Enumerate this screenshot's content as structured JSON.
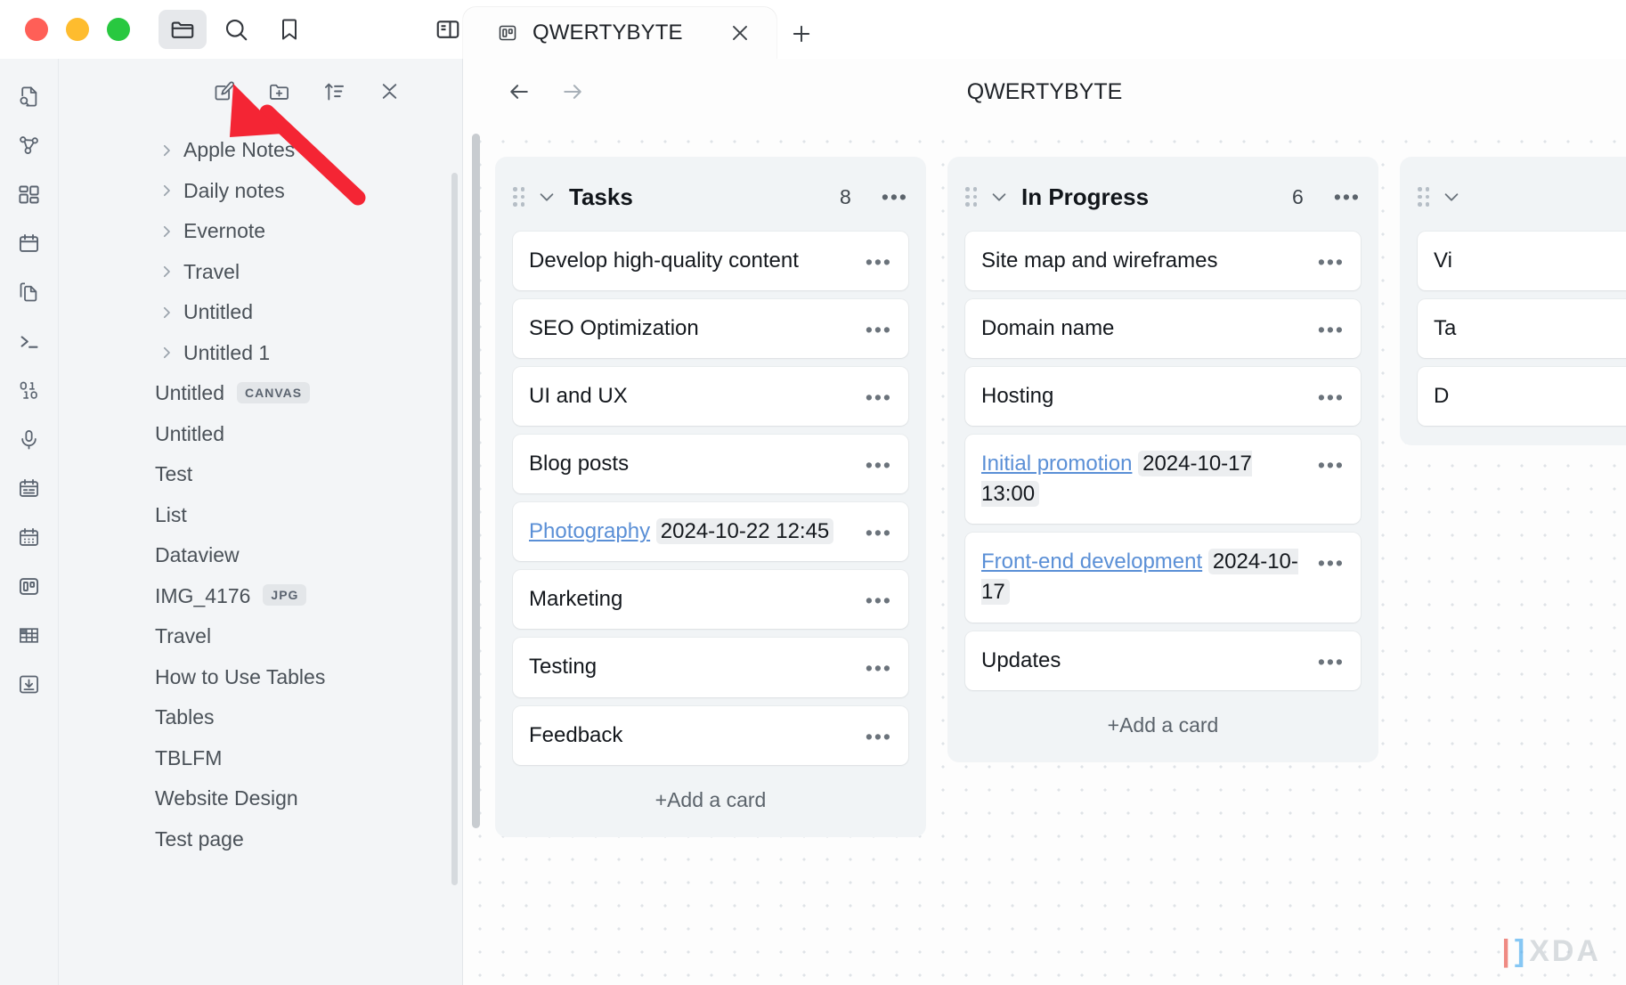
{
  "window": {
    "traffic_lights": [
      "close",
      "minimize",
      "zoom"
    ],
    "toolbar_buttons": [
      {
        "name": "files-icon",
        "label": "Files",
        "active": true
      },
      {
        "name": "search-icon",
        "label": "Search",
        "active": false
      },
      {
        "name": "bookmark-icon",
        "label": "Bookmarks",
        "active": false
      },
      {
        "name": "toggle-right-sidebar-icon",
        "label": "Toggle right sidebar",
        "active": false
      }
    ]
  },
  "tabs": {
    "items": [
      {
        "title": "QWERTYBYTE",
        "icon": "kanban-icon",
        "active": true
      }
    ],
    "close_label": "×",
    "new_tab_label": "+"
  },
  "rail": {
    "items": [
      {
        "name": "file-search-icon",
        "label": "Search in file"
      },
      {
        "name": "graph-view-icon",
        "label": "Graph view"
      },
      {
        "name": "canvas-icon",
        "label": "Canvas"
      },
      {
        "name": "calendar-icon",
        "label": "Calendar"
      },
      {
        "name": "copy-files-icon",
        "label": "Files"
      },
      {
        "name": "terminal-icon",
        "label": "Terminal"
      },
      {
        "name": "binary-icon",
        "label": "Binary"
      },
      {
        "name": "microphone-icon",
        "label": "Audio recorder"
      },
      {
        "name": "daily-note-icon",
        "label": "Daily note"
      },
      {
        "name": "month-calendar-icon",
        "label": "Month calendar"
      },
      {
        "name": "kanban-board-icon",
        "label": "Kanban board"
      },
      {
        "name": "table-icon",
        "label": "Table"
      },
      {
        "name": "import-icon",
        "label": "Import"
      }
    ]
  },
  "explorer": {
    "toolbar": [
      {
        "name": "new-note-icon",
        "label": "New note"
      },
      {
        "name": "new-folder-icon",
        "label": "New folder"
      },
      {
        "name": "sort-icon",
        "label": "Change sort order"
      },
      {
        "name": "collapse-all-icon",
        "label": "Collapse all"
      }
    ],
    "files": [
      {
        "label": "Apple Notes",
        "type": "folder"
      },
      {
        "label": "Daily notes",
        "type": "folder"
      },
      {
        "label": "Evernote",
        "type": "folder"
      },
      {
        "label": "Travel",
        "type": "folder"
      },
      {
        "label": "Untitled",
        "type": "folder"
      },
      {
        "label": "Untitled 1",
        "type": "folder"
      },
      {
        "label": "Untitled",
        "type": "file",
        "badge": "CANVAS"
      },
      {
        "label": "Untitled",
        "type": "file"
      },
      {
        "label": "Test",
        "type": "file"
      },
      {
        "label": "List",
        "type": "file"
      },
      {
        "label": "Dataview",
        "type": "file"
      },
      {
        "label": "IMG_4176",
        "type": "file",
        "badge": "JPG"
      },
      {
        "label": "Travel",
        "type": "file"
      },
      {
        "label": "How to Use Tables",
        "type": "file"
      },
      {
        "label": "Tables",
        "type": "file"
      },
      {
        "label": "TBLFM",
        "type": "file"
      },
      {
        "label": "Website Design",
        "type": "file"
      },
      {
        "label": "Test page",
        "type": "file"
      }
    ]
  },
  "main": {
    "title": "QWERTYBYTE",
    "back_label": "←",
    "forward_label": "→",
    "add_card_label": "+Add a card",
    "more_label": "•••"
  },
  "board": {
    "columns": [
      {
        "title": "Tasks",
        "count": "8",
        "cards": [
          {
            "text": "Develop high-quality content"
          },
          {
            "text": "SEO Optimization"
          },
          {
            "text": "UI and UX"
          },
          {
            "text": "Blog posts"
          },
          {
            "link": "Photography",
            "date": "2024-10-22 12:45"
          },
          {
            "text": "Marketing"
          },
          {
            "text": "Testing"
          },
          {
            "text": "Feedback"
          }
        ],
        "show_add": true
      },
      {
        "title": "In Progress",
        "count": "6",
        "cards": [
          {
            "text": "Site map and wireframes"
          },
          {
            "text": "Domain name"
          },
          {
            "text": "Hosting"
          },
          {
            "link": "Initial promotion",
            "date": "2024-10-17 13:00"
          },
          {
            "link": "Front-end development",
            "date": "2024-10-17"
          },
          {
            "text": "Updates"
          }
        ],
        "show_add": true
      },
      {
        "title": "",
        "count": "",
        "cards": [
          {
            "text": "Vi"
          },
          {
            "text": "Ta"
          },
          {
            "text": "D"
          }
        ],
        "show_add": false,
        "clipped": true
      }
    ]
  },
  "watermark": {
    "brand": "XDA"
  }
}
